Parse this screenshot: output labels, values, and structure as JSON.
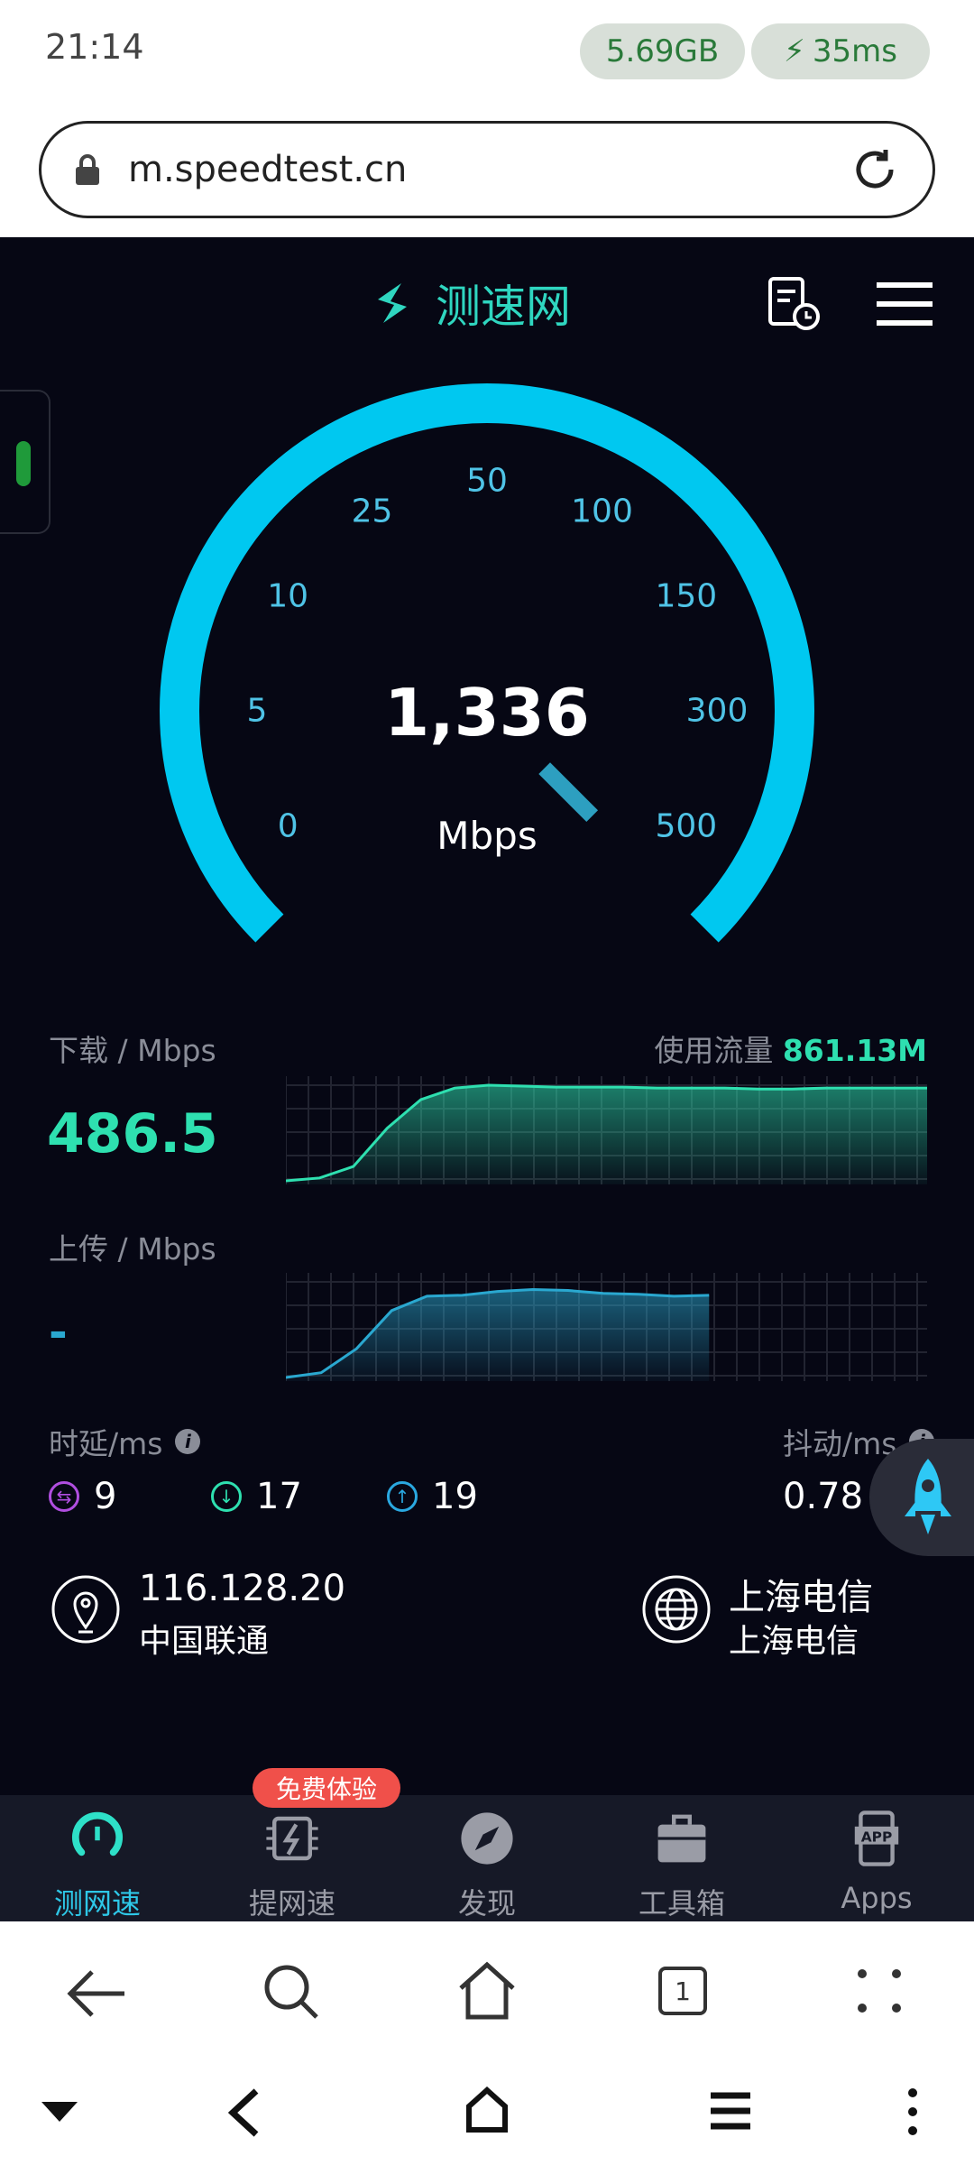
{
  "status_bar": {
    "time": "21:14",
    "data_usage": "5.69GB",
    "ping": "35ms"
  },
  "browser": {
    "url": "m.speedtest.cn",
    "tab_count": "1"
  },
  "header": {
    "logo_text": "测速网"
  },
  "gauge": {
    "value": "1,336",
    "unit": "Mbps",
    "ticks": [
      "0",
      "5",
      "10",
      "25",
      "50",
      "100",
      "150",
      "300",
      "500"
    ],
    "accent": "#00c8f0"
  },
  "download": {
    "label": "下载 / Mbps",
    "value": "486.5",
    "traffic_label": "使用流量",
    "traffic_value": "861.13M",
    "color": "#2ee0b0",
    "series": [
      0,
      3,
      15,
      55,
      85,
      97,
      100,
      99,
      98,
      98,
      98,
      97,
      97,
      97,
      96,
      96,
      97,
      97,
      97,
      97
    ]
  },
  "upload": {
    "label": "上传 / Mbps",
    "value": "-",
    "color": "#2aa8d0",
    "series": [
      0,
      5,
      30,
      70,
      85,
      86,
      90,
      92,
      91,
      88,
      87,
      85,
      86
    ],
    "progress": 0.66
  },
  "latency": {
    "label": "时延/ms",
    "idle": "9",
    "download": "17",
    "upload": "19"
  },
  "jitter": {
    "label": "抖动/ms",
    "value": "0.78"
  },
  "client": {
    "ip": "116.128.20",
    "isp": "中国联通"
  },
  "server": {
    "name": "上海电信",
    "isp": "上海电信"
  },
  "bottom_nav": {
    "badge": "免费体验",
    "items": [
      {
        "label": "测网速",
        "icon": "speedometer-icon"
      },
      {
        "label": "提网速",
        "icon": "chip-bolt-icon"
      },
      {
        "label": "发现",
        "icon": "compass-icon"
      },
      {
        "label": "工具箱",
        "icon": "toolbox-icon"
      },
      {
        "label": "Apps",
        "icon": "app-phone-icon"
      }
    ]
  }
}
